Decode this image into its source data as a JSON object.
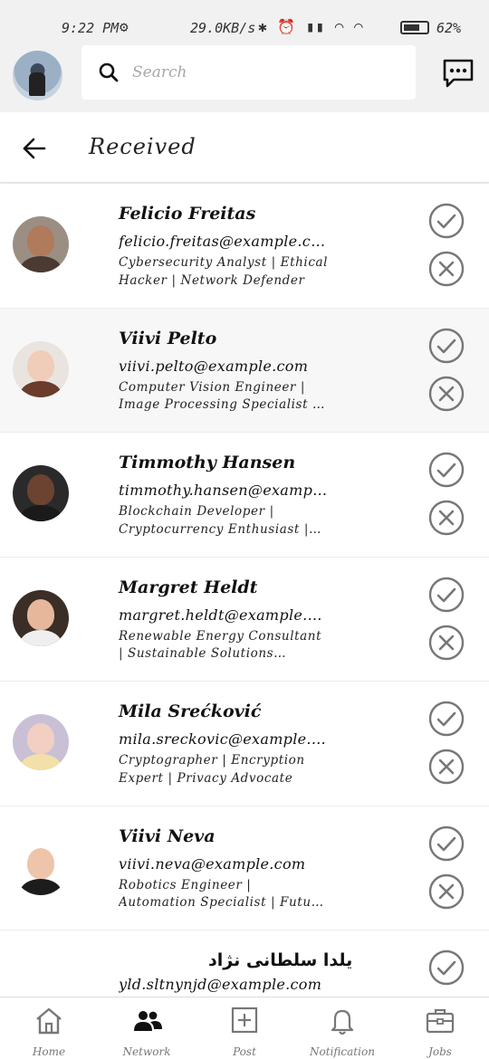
{
  "status_bar": {
    "time": "9:22 PM",
    "net_speed": "29.0KB/s",
    "battery": "62%"
  },
  "search": {
    "placeholder": "Search"
  },
  "header": {
    "title": "Received"
  },
  "requests": [
    {
      "name": "Felicio Freitas",
      "email": "felicio.freitas@example.com",
      "bio": "Cybersecurity Analyst | Ethical Hacker | Network Defender",
      "skin": "#b07a5c",
      "shirt": "#4a3a32",
      "bg": "#9b8f84"
    },
    {
      "name": "Viivi Pelto",
      "email": "viivi.pelto@example.com",
      "bio": "Computer Vision Engineer | Image Processing Specialist | Vision AI Researcher",
      "skin": "#f0cdb8",
      "shirt": "#6b3b2b",
      "bg": "#e9e4e0"
    },
    {
      "name": "Timmothy Hansen",
      "email": "timmothy.hansen@example.com",
      "bio": "Blockchain Developer | Cryptocurrency Enthusiast | DApp Builder",
      "skin": "#6b4330",
      "shirt": "#1a1a1a",
      "bg": "#2a2a2a"
    },
    {
      "name": "Margret Heldt",
      "email": "margret.heldt@example.com",
      "bio": "Renewable Energy Consultant | Sustainable Solutions Advocate",
      "skin": "#e6b79a",
      "shirt": "#efefef",
      "bg": "#3a2e26"
    },
    {
      "name": "Mila Srećković",
      "email": "mila.sreckovic@example.com",
      "bio": "Cryptographer | Encryption Expert | Privacy Advocate",
      "skin": "#f2cfc2",
      "shirt": "#f3e0a8",
      "bg": "#c9c0d6"
    },
    {
      "name": "Viivi Neva",
      "email": "viivi.neva@example.com",
      "bio": "Robotics Engineer | Automation Specialist | Future Technologist",
      "skin": "#eec4aa",
      "shirt": "#1c1c1c",
      "bg": "#ffffff"
    },
    {
      "name": "یلدا سلطانی نژاد",
      "email": "yld.sltnynjd@example.com",
      "bio": "",
      "skin": "#d9b59a",
      "shirt": "#444",
      "bg": "#ffffff"
    }
  ],
  "nav": [
    {
      "label": "Home",
      "icon": "home-icon"
    },
    {
      "label": "Network",
      "icon": "network-icon"
    },
    {
      "label": "Post",
      "icon": "post-icon"
    },
    {
      "label": "Notification",
      "icon": "bell-icon"
    },
    {
      "label": "Jobs",
      "icon": "briefcase-icon"
    }
  ]
}
